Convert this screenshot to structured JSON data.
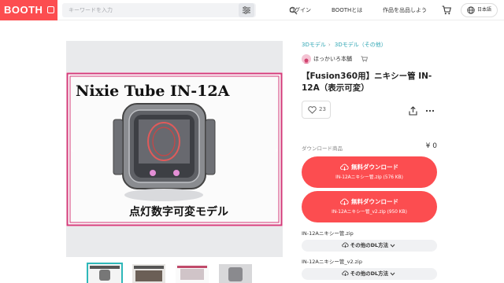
{
  "header": {
    "logo": "BOOTH",
    "search_placeholder": "キーワードを入力",
    "nav": [
      "ログイン",
      "BOOTHとは",
      "作品を出品しよう"
    ],
    "language": "日本語"
  },
  "product_image": {
    "title_text": "Nixie Tube IN-12A",
    "caption_text": "点灯数字可変モデル"
  },
  "breadcrumb": [
    "3Dモデル",
    "3Dモデル（その他）"
  ],
  "shop": {
    "name": "ほっかいろ本舗"
  },
  "product": {
    "title": "【Fusion360用】ニキシー管 IN-12A（表示可変）",
    "likes": "23"
  },
  "download": {
    "label": "ダウンロード商品",
    "price": "¥ 0",
    "buttons": [
      {
        "label": "無料ダウンロード",
        "file": "IN-12Aニキシー管.zip (576 KB)"
      },
      {
        "label": "無料ダウンロード",
        "file": "IN-12Aニキシー管_v2.zip (950 KB)"
      }
    ],
    "files": [
      {
        "name": "IN-12Aニキシー管.zip",
        "other_label": "その他のDL方法"
      },
      {
        "name": "IN-12Aニキシー管_v2.zip",
        "other_label": "その他のDL方法"
      }
    ]
  },
  "colors": {
    "accent": "#fc4d50",
    "link": "#2fa6b4",
    "thumb_active": "#2fb8b9"
  }
}
